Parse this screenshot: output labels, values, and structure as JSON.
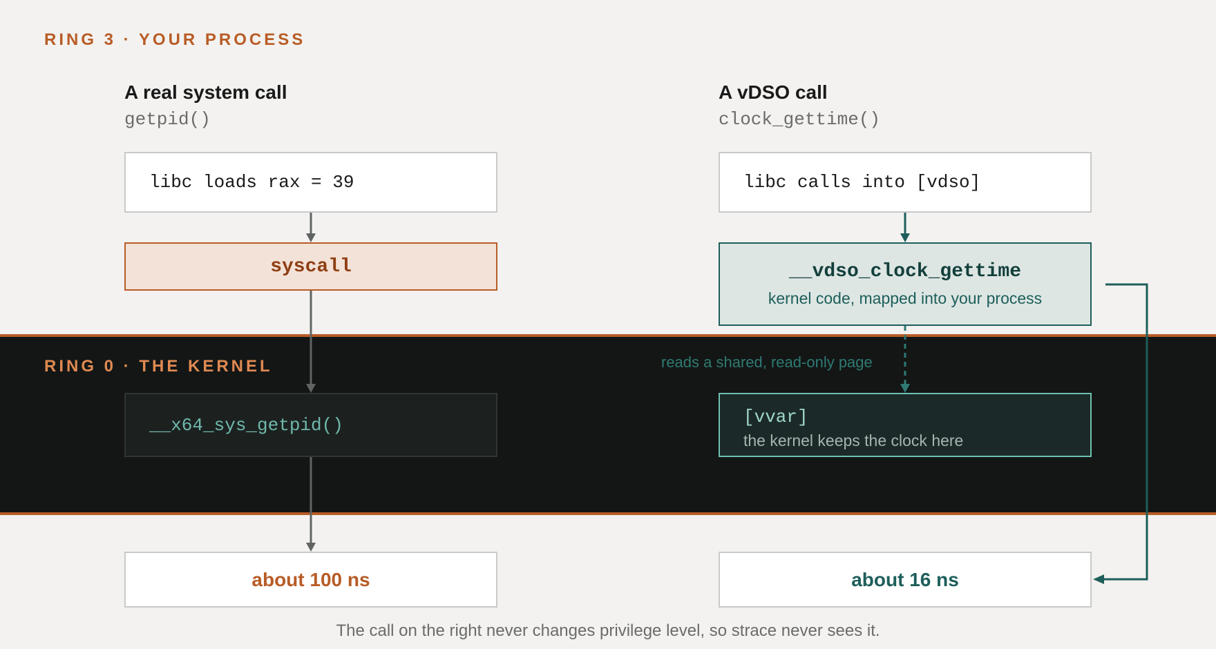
{
  "ring3": {
    "label": "RING 3 · YOUR PROCESS"
  },
  "ring0": {
    "label": "RING 0 · THE KERNEL"
  },
  "left": {
    "title": "A real system call",
    "subtitle": "getpid()",
    "step1": "libc loads rax = 39",
    "instruction": "syscall",
    "kernel_fn": "__x64_sys_getpid()",
    "result": "about 100 ns"
  },
  "right": {
    "title": "A vDSO call",
    "subtitle": "clock_gettime()",
    "step1": "libc calls into [vdso]",
    "vdso_fn": "__vdso_clock_gettime",
    "vdso_desc": "kernel code, mapped into your process",
    "dashed_label": "reads a shared, read-only page",
    "vvar_title": "[vvar]",
    "vvar_desc": "the kernel keeps the clock here",
    "result": "about 16 ns"
  },
  "footer": "The call on the right never changes privilege level, so strace never sees it.",
  "colors": {
    "accent_orange": "#b85c26",
    "accent_teal": "#1d5e5a",
    "kernel_bg": "#131615",
    "page_bg": "#f3f2f0"
  }
}
